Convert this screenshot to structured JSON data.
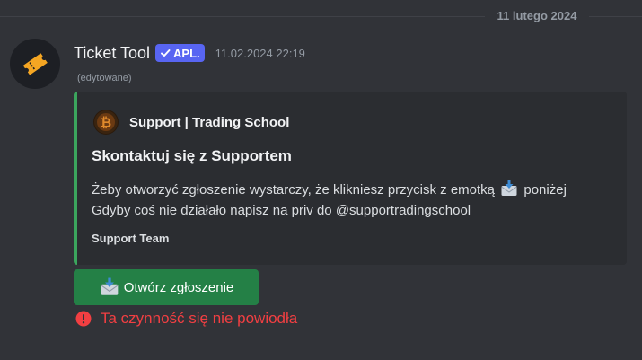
{
  "date_divider": "11 lutego 2024",
  "message": {
    "username": "Ticket Tool",
    "app_badge": "APL.",
    "timestamp": "11.02.2024 22:19",
    "edited_label": "(edytowane)",
    "avatar_icon": "ticket-icon"
  },
  "embed": {
    "accent_color": "#3ba55d",
    "author_icon": "bitcoin-logo-icon",
    "author_name": "Support | Trading School",
    "title": "Skontaktuj się z Supportem",
    "description_line1_before": "Żeby otworzyć zgłoszenie wystarczy, że klikniesz przycisk z emotką",
    "description_line1_after": "poniżej",
    "description_line2": "Gdyby coś nie działało napisz na priv do @supportradingschool",
    "footer": "Support Team"
  },
  "button": {
    "label": "Otwórz zgłoszenie",
    "icon": "envelope-with-arrow-icon",
    "color": "#248046"
  },
  "error": {
    "text": "Ta czynność się nie powiodła",
    "icon": "error-circle-icon",
    "color": "#f23f42"
  }
}
